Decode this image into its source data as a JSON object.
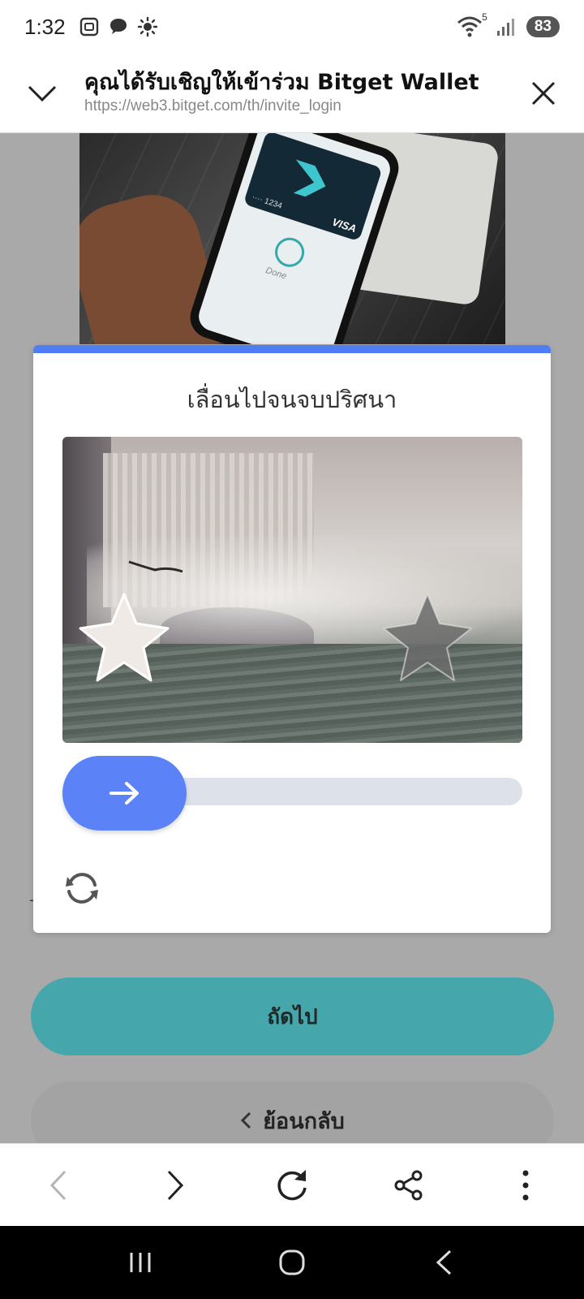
{
  "status_bar": {
    "time": "1:32",
    "wifi_badge": "5",
    "battery": "83",
    "icons_left": [
      "screenshot-icon",
      "chat-bubble-icon",
      "brightness-icon"
    ],
    "icons_right": [
      "wifi-icon",
      "signal-icon",
      "battery-icon"
    ]
  },
  "browser_header": {
    "title": "คุณได้รับเชิญให้เข้าร่วม Bitget Wallet",
    "url": "https://web3.bitget.com/th/invite_login",
    "collapse_icon": "chevron-down-icon",
    "close_icon": "close-icon"
  },
  "hero": {
    "card_number": "···· 1234",
    "card_brand": "VISA",
    "done_label": "Done"
  },
  "captcha": {
    "title": "เลื่อนไปจนจบปริศนา",
    "slider_progress": 0,
    "handle_icon": "arrow-right-icon",
    "refresh_icon": "refresh-icon",
    "accent_color": "#4f7ef3"
  },
  "page": {
    "next_label": "ถัดไป",
    "back_label": "ย้อนกลับ",
    "stray_mark": "-",
    "next_color": "#45a6ab"
  },
  "browser_toolbar": {
    "buttons": [
      "back-icon",
      "forward-icon",
      "reload-icon",
      "share-icon",
      "more-icon"
    ]
  },
  "nav_bar": {
    "buttons": [
      "recents-icon",
      "home-icon",
      "back-icon"
    ]
  }
}
